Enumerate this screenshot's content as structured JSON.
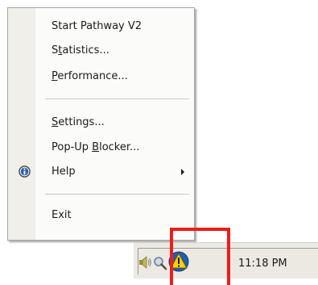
{
  "menu": {
    "items": [
      {
        "label_pre": "",
        "label_u": "",
        "label_post": "Start Pathway V2"
      },
      {
        "label_pre": "S",
        "label_u": "t",
        "label_post": "atistics..."
      },
      {
        "label_pre": "",
        "label_u": "P",
        "label_post": "erformance..."
      },
      {
        "label_pre": "",
        "label_u": "S",
        "label_post": "ettings..."
      },
      {
        "label_pre": "Pop-Up ",
        "label_u": "B",
        "label_post": "locker..."
      },
      {
        "label_pre": "",
        "label_u": "",
        "label_post": "Help"
      },
      {
        "label_pre": "",
        "label_u": "",
        "label_post": "Exit"
      }
    ]
  },
  "tray": {
    "clock": "11:18 PM",
    "icons": [
      "speaker-icon",
      "network-search-icon",
      "warning-icon"
    ]
  },
  "colors": {
    "highlight": "#ef1b1b",
    "warning_yellow": "#ffd200",
    "warning_blue": "#1e5fb5"
  }
}
